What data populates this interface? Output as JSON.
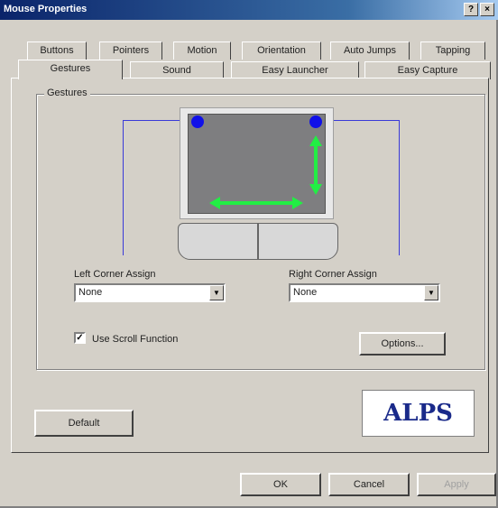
{
  "window": {
    "title": "Mouse Properties",
    "help_btn": "?",
    "close_btn": "×"
  },
  "tabs_back": [
    "Buttons",
    "Pointers",
    "Motion",
    "Orientation",
    "Auto Jumps",
    "Tapping"
  ],
  "tabs_front": [
    "Gestures",
    "Sound",
    "Easy Launcher",
    "Easy Capture"
  ],
  "active_tab": "Gestures",
  "gestures": {
    "group_label": "Gestures",
    "left_corner": {
      "label": "Left Corner Assign",
      "value": "None"
    },
    "right_corner": {
      "label": "Right Corner Assign",
      "value": "None"
    },
    "scroll": {
      "label": "Use Scroll Function",
      "checked": true
    },
    "options_label": "Options...",
    "colors": {
      "corner_dot": "#1010e8",
      "gesture_arrow": "#22ee44",
      "leader": "#3a3ad8"
    }
  },
  "default_label": "Default",
  "logo_text": "ALPS",
  "footer": {
    "ok": "OK",
    "cancel": "Cancel",
    "apply": "Apply"
  }
}
